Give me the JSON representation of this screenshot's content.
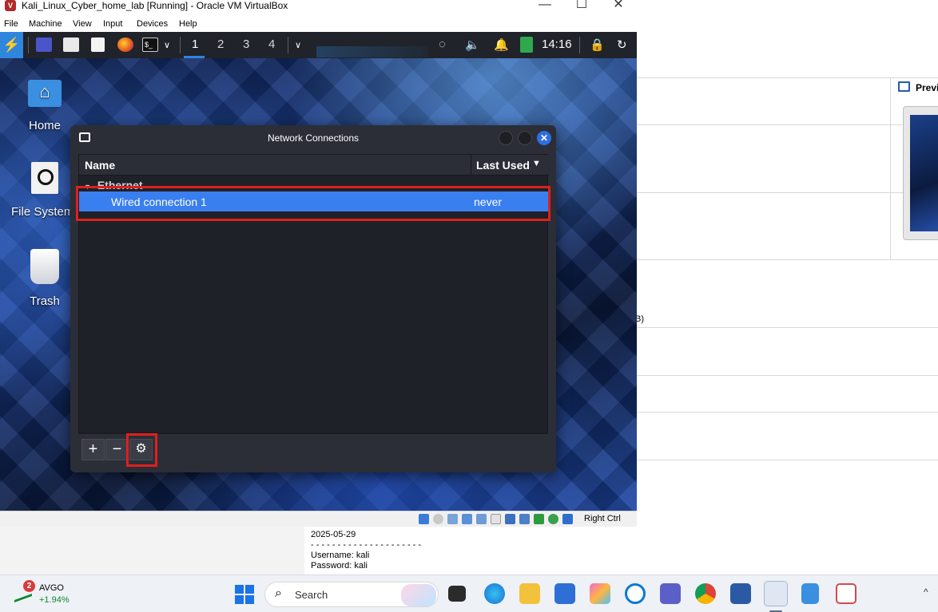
{
  "window": {
    "title": "Kali_Linux_Cyber_home_lab [Running] - Oracle VM VirtualBox",
    "controls": {
      "minimize": "—",
      "maximize": "☐",
      "close": "✕"
    },
    "menu": [
      "File",
      "Machine",
      "View",
      "Input",
      "Devices",
      "Help"
    ]
  },
  "kali_panel": {
    "workspaces": [
      "1",
      "2",
      "3",
      "4"
    ],
    "active_workspace": "1",
    "clock": "14:16",
    "icons": [
      "kali-menu-icon",
      "desktop-icon",
      "file-manager-icon",
      "text-editor-icon",
      "firefox-icon",
      "terminal-icon",
      "chevron-down-icon",
      "network-activity-icon",
      "volume-icon",
      "bell-icon",
      "battery-icon",
      "lock-icon",
      "logout-icon"
    ]
  },
  "desktop": {
    "icons": [
      {
        "label": "Home"
      },
      {
        "label": "File System"
      },
      {
        "label": "Trash"
      }
    ]
  },
  "dialog": {
    "title": "Network Connections",
    "columns": {
      "name": "Name",
      "last_used": "Last Used"
    },
    "group": "Ethernet",
    "rows": [
      {
        "name": "Wired connection 1",
        "last_used": "never"
      }
    ],
    "toolbar": {
      "add": "+",
      "remove": "−",
      "settings": "⚙"
    }
  },
  "vbox_status": {
    "host_key": "Right Ctrl"
  },
  "background_manager": {
    "preview_label": "Preview",
    "partial_text": "B)",
    "notes": [
      "2025-05-29",
      "- - - - - - - - - - - - - - - - - - - - -",
      "Username: kali",
      "Password: kali"
    ]
  },
  "taskbar": {
    "stock": {
      "badge": "2",
      "symbol": "AVGO",
      "change": "+1.94%"
    },
    "search_placeholder": "Search",
    "apps": [
      "file-explorer-icon",
      "edge-icon",
      "folder-icon",
      "store-icon",
      "copilot-icon",
      "cortana-icon",
      "teams-icon",
      "chrome-icon",
      "virtualbox-icon",
      "vm-icon",
      "notepad-icon",
      "snipping-tool-icon"
    ],
    "tray_caret": "^"
  },
  "colors": {
    "selection": "#3a7ff0",
    "highlight_box": "#e01f1f",
    "kali_accent": "#2e86de"
  }
}
